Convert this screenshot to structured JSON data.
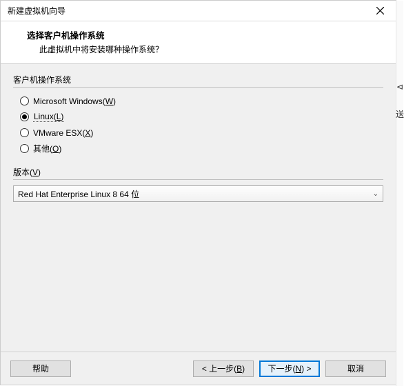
{
  "window": {
    "title": "新建虚拟机向导"
  },
  "header": {
    "title": "选择客户机操作系统",
    "subtitle": "此虚拟机中将安装哪种操作系统？"
  },
  "os_group": {
    "label": "客户机操作系统",
    "options": [
      {
        "text": "Microsoft Windows(",
        "accel": "W",
        "suffix": ")",
        "checked": false
      },
      {
        "text": "Linux(",
        "accel": "L",
        "suffix": ")",
        "checked": true
      },
      {
        "text": "VMware ESX(",
        "accel": "X",
        "suffix": ")",
        "checked": false
      },
      {
        "text": "其他(",
        "accel": "O",
        "suffix": ")",
        "checked": false
      }
    ]
  },
  "version": {
    "label_prefix": "版本(",
    "label_accel": "V",
    "label_suffix": ")",
    "selected": "Red Hat Enterprise Linux 8 64 位"
  },
  "buttons": {
    "help": "帮助",
    "back_prefix": "< 上一步(",
    "back_accel": "B",
    "back_suffix": ")",
    "next_prefix": "下一步(",
    "next_accel": "N",
    "next_suffix": ") >",
    "cancel": "取消"
  },
  "side": {
    "mark1": "⊲",
    "mark2": "送"
  }
}
